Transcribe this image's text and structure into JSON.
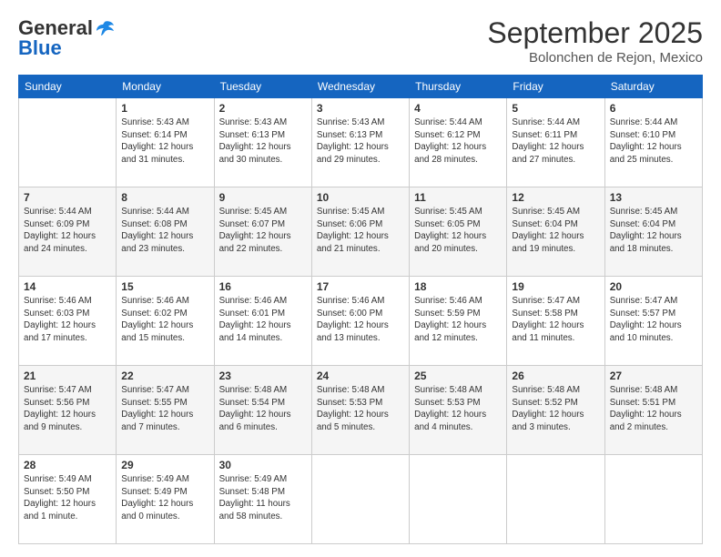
{
  "header": {
    "logo_general": "General",
    "logo_blue": "Blue",
    "month_title": "September 2025",
    "location": "Bolonchen de Rejon, Mexico"
  },
  "weekdays": [
    "Sunday",
    "Monday",
    "Tuesday",
    "Wednesday",
    "Thursday",
    "Friday",
    "Saturday"
  ],
  "weeks": [
    [
      {
        "day": "",
        "info": ""
      },
      {
        "day": "1",
        "info": "Sunrise: 5:43 AM\nSunset: 6:14 PM\nDaylight: 12 hours\nand 31 minutes."
      },
      {
        "day": "2",
        "info": "Sunrise: 5:43 AM\nSunset: 6:13 PM\nDaylight: 12 hours\nand 30 minutes."
      },
      {
        "day": "3",
        "info": "Sunrise: 5:43 AM\nSunset: 6:13 PM\nDaylight: 12 hours\nand 29 minutes."
      },
      {
        "day": "4",
        "info": "Sunrise: 5:44 AM\nSunset: 6:12 PM\nDaylight: 12 hours\nand 28 minutes."
      },
      {
        "day": "5",
        "info": "Sunrise: 5:44 AM\nSunset: 6:11 PM\nDaylight: 12 hours\nand 27 minutes."
      },
      {
        "day": "6",
        "info": "Sunrise: 5:44 AM\nSunset: 6:10 PM\nDaylight: 12 hours\nand 25 minutes."
      }
    ],
    [
      {
        "day": "7",
        "info": "Sunrise: 5:44 AM\nSunset: 6:09 PM\nDaylight: 12 hours\nand 24 minutes."
      },
      {
        "day": "8",
        "info": "Sunrise: 5:44 AM\nSunset: 6:08 PM\nDaylight: 12 hours\nand 23 minutes."
      },
      {
        "day": "9",
        "info": "Sunrise: 5:45 AM\nSunset: 6:07 PM\nDaylight: 12 hours\nand 22 minutes."
      },
      {
        "day": "10",
        "info": "Sunrise: 5:45 AM\nSunset: 6:06 PM\nDaylight: 12 hours\nand 21 minutes."
      },
      {
        "day": "11",
        "info": "Sunrise: 5:45 AM\nSunset: 6:05 PM\nDaylight: 12 hours\nand 20 minutes."
      },
      {
        "day": "12",
        "info": "Sunrise: 5:45 AM\nSunset: 6:04 PM\nDaylight: 12 hours\nand 19 minutes."
      },
      {
        "day": "13",
        "info": "Sunrise: 5:45 AM\nSunset: 6:04 PM\nDaylight: 12 hours\nand 18 minutes."
      }
    ],
    [
      {
        "day": "14",
        "info": "Sunrise: 5:46 AM\nSunset: 6:03 PM\nDaylight: 12 hours\nand 17 minutes."
      },
      {
        "day": "15",
        "info": "Sunrise: 5:46 AM\nSunset: 6:02 PM\nDaylight: 12 hours\nand 15 minutes."
      },
      {
        "day": "16",
        "info": "Sunrise: 5:46 AM\nSunset: 6:01 PM\nDaylight: 12 hours\nand 14 minutes."
      },
      {
        "day": "17",
        "info": "Sunrise: 5:46 AM\nSunset: 6:00 PM\nDaylight: 12 hours\nand 13 minutes."
      },
      {
        "day": "18",
        "info": "Sunrise: 5:46 AM\nSunset: 5:59 PM\nDaylight: 12 hours\nand 12 minutes."
      },
      {
        "day": "19",
        "info": "Sunrise: 5:47 AM\nSunset: 5:58 PM\nDaylight: 12 hours\nand 11 minutes."
      },
      {
        "day": "20",
        "info": "Sunrise: 5:47 AM\nSunset: 5:57 PM\nDaylight: 12 hours\nand 10 minutes."
      }
    ],
    [
      {
        "day": "21",
        "info": "Sunrise: 5:47 AM\nSunset: 5:56 PM\nDaylight: 12 hours\nand 9 minutes."
      },
      {
        "day": "22",
        "info": "Sunrise: 5:47 AM\nSunset: 5:55 PM\nDaylight: 12 hours\nand 7 minutes."
      },
      {
        "day": "23",
        "info": "Sunrise: 5:48 AM\nSunset: 5:54 PM\nDaylight: 12 hours\nand 6 minutes."
      },
      {
        "day": "24",
        "info": "Sunrise: 5:48 AM\nSunset: 5:53 PM\nDaylight: 12 hours\nand 5 minutes."
      },
      {
        "day": "25",
        "info": "Sunrise: 5:48 AM\nSunset: 5:53 PM\nDaylight: 12 hours\nand 4 minutes."
      },
      {
        "day": "26",
        "info": "Sunrise: 5:48 AM\nSunset: 5:52 PM\nDaylight: 12 hours\nand 3 minutes."
      },
      {
        "day": "27",
        "info": "Sunrise: 5:48 AM\nSunset: 5:51 PM\nDaylight: 12 hours\nand 2 minutes."
      }
    ],
    [
      {
        "day": "28",
        "info": "Sunrise: 5:49 AM\nSunset: 5:50 PM\nDaylight: 12 hours\nand 1 minute."
      },
      {
        "day": "29",
        "info": "Sunrise: 5:49 AM\nSunset: 5:49 PM\nDaylight: 12 hours\nand 0 minutes."
      },
      {
        "day": "30",
        "info": "Sunrise: 5:49 AM\nSunset: 5:48 PM\nDaylight: 11 hours\nand 58 minutes."
      },
      {
        "day": "",
        "info": ""
      },
      {
        "day": "",
        "info": ""
      },
      {
        "day": "",
        "info": ""
      },
      {
        "day": "",
        "info": ""
      }
    ]
  ]
}
